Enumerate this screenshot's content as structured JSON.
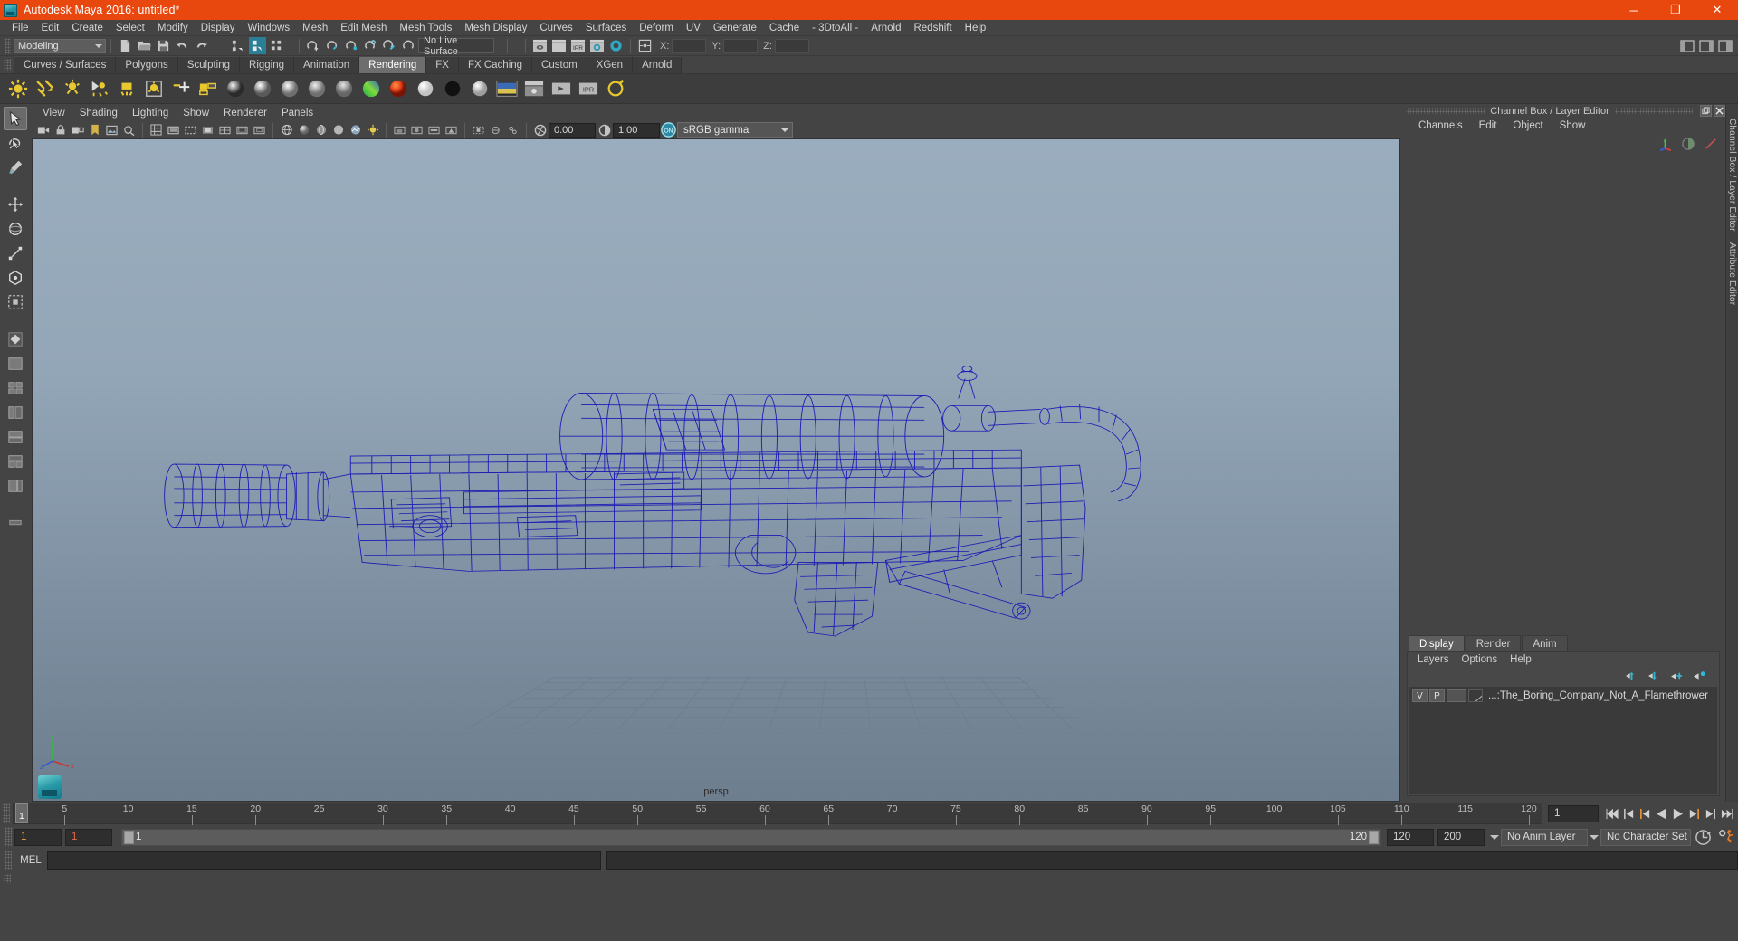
{
  "window": {
    "title": "Autodesk Maya 2016: untitled*",
    "minimize": "─",
    "maximize": "❐",
    "close": "✕",
    "title_bar_color": "#e8470e"
  },
  "menubar": {
    "items": [
      "File",
      "Edit",
      "Create",
      "Select",
      "Modify",
      "Display",
      "Windows",
      "Mesh",
      "Edit Mesh",
      "Mesh Tools",
      "Mesh Display",
      "Curves",
      "Surfaces",
      "Deform",
      "UV",
      "Generate",
      "Cache",
      "- 3DtoAll -",
      "Arnold",
      "Redshift",
      "Help"
    ]
  },
  "statusline": {
    "menuset": "Modeling",
    "live_surface": "No Live Surface",
    "coord_x_label": "X:",
    "coord_y_label": "Y:",
    "coord_z_label": "Z:",
    "coord_x_value": "",
    "coord_y_value": "",
    "coord_z_value": ""
  },
  "shelf": {
    "tabs": [
      "Curves / Surfaces",
      "Polygons",
      "Sculpting",
      "Rigging",
      "Animation",
      "Rendering",
      "FX",
      "FX Caching",
      "Custom",
      "XGen",
      "Arnold"
    ],
    "active_tab": "Rendering"
  },
  "viewport": {
    "menus": [
      "View",
      "Shading",
      "Lighting",
      "Show",
      "Renderer",
      "Panels"
    ],
    "exposure": "0.00",
    "gamma": "1.00",
    "color_transform": "sRGB gamma",
    "color_transform_toggle": "ON",
    "camera_label": "persp",
    "axis_x": "x",
    "axis_y": "y",
    "axis_z": "z",
    "wireframe_color": "#1818b4",
    "bg_top": "#9aadbe",
    "bg_bottom": "#6d7e8e"
  },
  "channelbox": {
    "dock_title": "Channel Box / Layer Editor",
    "menus": [
      "Channels",
      "Edit",
      "Object",
      "Show"
    ]
  },
  "layer_editor": {
    "tabs": [
      "Display",
      "Render",
      "Anim"
    ],
    "active_tab": "Display",
    "menus": [
      "Layers",
      "Options",
      "Help"
    ],
    "layers": [
      {
        "visibility": "V",
        "playback": "P",
        "name": "...:The_Boring_Company_Not_A_Flamethrower"
      }
    ]
  },
  "side_tabs": [
    "Channel Box / Layer Editor",
    "Attribute Editor"
  ],
  "timeline": {
    "ticks": [
      "5",
      "10",
      "15",
      "20",
      "25",
      "30",
      "35",
      "40",
      "45",
      "50",
      "55",
      "60",
      "65",
      "70",
      "75",
      "80",
      "85",
      "90",
      "95",
      "100",
      "105",
      "110",
      "115",
      "120"
    ],
    "current_frame": "1",
    "current_frame_field": "1",
    "playback_buttons": [
      "go-to-start",
      "step-back-key",
      "step-back-frame",
      "play-backwards",
      "play-forwards",
      "step-forward-frame",
      "step-forward-key",
      "go-to-end"
    ]
  },
  "range": {
    "anim_start": "1",
    "range_start": "1",
    "slider_start_label": "1",
    "slider_end_label": "120",
    "range_end": "120",
    "anim_end": "200",
    "anim_layer": "No Anim Layer",
    "character_set": "No Character Set"
  },
  "command_line": {
    "language_label": "MEL",
    "input_value": "",
    "output_value": ""
  }
}
